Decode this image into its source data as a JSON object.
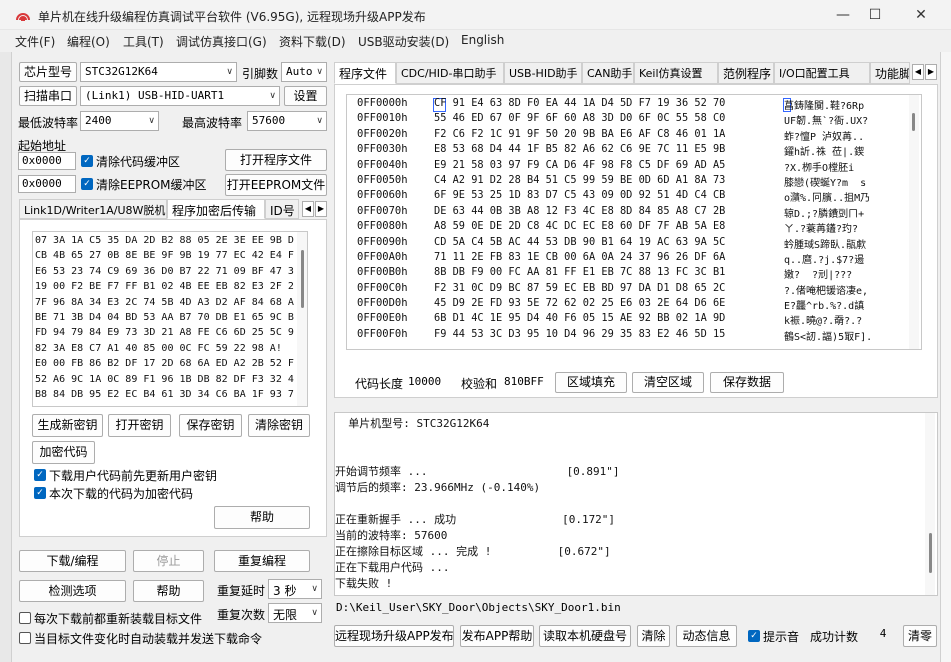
{
  "window": {
    "title": "单片机在线升级编程仿真调试平台软件 (V6.95G), 远程现场升级APP发布",
    "minimize": "—",
    "maximize": "☐",
    "close": "✕"
  },
  "menu": [
    "文件(F)",
    "编程(O)",
    "工具(T)",
    "调试仿真接口(G)",
    "资料下载(D)",
    "USB驱动安装(D)",
    "English"
  ],
  "left": {
    "chip_btn": "芯片型号",
    "chip_value": "STC32G12K64",
    "pin_label": "引脚数",
    "pin_value": "Auto",
    "scan_btn": "扫描串口",
    "port_value": "(Link1) USB-HID-UART1",
    "settings_btn": "设置",
    "min_baud_label": "最低波特率",
    "min_baud_value": "2400",
    "max_baud_label": "最高波特率",
    "max_baud_value": "57600",
    "start_addr_label": "起始地址",
    "addr1": "0x0000",
    "clear_code_label": "清除代码缓冲区",
    "open_prog_btn": "打开程序文件",
    "addr2": "0x0000",
    "clear_eeprom_label": "清除EEPROM缓冲区",
    "open_eeprom_btn": "打开EEPROM文件",
    "tabs": [
      "Link1D/Writer1A/U8W脱机",
      "程序加密后传输",
      "ID号"
    ],
    "hex_lines": [
      "07 3A 1A C5 35 DA 2D B2 88 05 2E 3E EE 9B D(",
      "CB 4B 65 27 0B 8E BE 9F 9B 19 77 EC 42 E4 F",
      "E6 53 23 74 C9 69 36 D0 B7 22 71 09 BF 47 3!",
      "19 00 F2 BE F7 FF B1 02 4B EE EB 82 E3 2F 2",
      "7F 96 8A 34 E3 2C 74 5B 4D A3 D2 AF 84 68 A",
      "BE 71 3B D4 04 BD 53 AA B7 70 DB E1 65 9C B(",
      "FD 94 79 84 E9 73 3D 21 A8 FE C6 6D 25 5C 9",
      "82 3A E8 C7 A1 40 85 00 0C FC 59 22 98 A!",
      "E0 00 FB 86 B2 DF 17 2D 68 6A ED A2 2B 52 F(",
      "52 A6 9C 1A 0C 89 F1 96 1B DB 82 DF F3 32 4",
      "B8 84 DB 95 E2 EC B4 61 3D 34 C6 BA 1F 93 7"
    ],
    "gen_key_btn": "生成新密钥",
    "open_key_btn": "打开密钥",
    "save_key_btn": "保存密钥",
    "clear_key_btn": "清除密钥",
    "encrypt_btn": "加密代码",
    "update_key_label": "下载用户代码前先更新用户密钥",
    "encrypt_download_label": "本次下载的代码为加密代码",
    "help_btn": "帮助",
    "download_btn": "下载/编程",
    "stop_btn": "停止",
    "reprogram_btn": "重复编程",
    "check_btn": "检测选项",
    "help2_btn": "帮助",
    "repeat_delay_label": "重复延时",
    "repeat_delay_value": "3 秒",
    "repeat_count_label": "重复次数",
    "repeat_count_value": "无限",
    "reload_label": "每次下载前都重新装载目标文件",
    "auto_label": "当目标文件变化时自动装载并发送下载命令"
  },
  "right": {
    "tabs": [
      "程序文件",
      "CDC/HID-串口助手",
      "USB-HID助手",
      "CAN助手",
      "Keil仿真设置",
      "范例程序",
      "I/O口配置工具",
      "功能脚"
    ],
    "hexdump": [
      {
        "addr": "0FF0000h",
        "bytes": "CF 91 E4 63 8D F0 EA 44 1A D4 5D F7 19 36 52 70",
        "ascii": "菖鋳隆闃.鞋?6Rp"
      },
      {
        "addr": "0FF0010h",
        "bytes": "55 46 ED 67 0F 9F 6F 60 A8 3D D0 6F 0C 55 58 C0",
        "ascii": "UF韌.無`?衙.UX?"
      },
      {
        "addr": "0FF0020h",
        "bytes": "F2 C6 F2 1C 91 9F 50 20 9B BA E6 AF C8 46 01 1A",
        "ascii": "蚱?憻P 泸奴苒.."
      },
      {
        "addr": "0FF0030h",
        "bytes": "E8 53 68 D4 44 1F B5 82 A6 62 C6 9E 7C 11 E5 9B",
        "ascii": "鑃h訢.祩 莅|.鍥"
      },
      {
        "addr": "0FF0040h",
        "bytes": "E9 21 58 03 97 F9 CA D6 4F 98 F8 C5 DF 69 AD A5",
        "ascii": "?X.栁手O樘胚i"
      },
      {
        "addr": "0FF0050h",
        "bytes": "C4 A2 91 D2 28 B4 51 C5 99 59 BE 0D 6D A1 8A 73",
        "ascii": "膝戀(碶蜒Y?m  s"
      },
      {
        "addr": "0FF0060h",
        "bytes": "6F 9E 53 25 1D 83 D7 C5 43 09 0D 92 51 4D C4 CB",
        "ascii": "o濻%.冋臏..抯M乃"
      },
      {
        "addr": "0FF0070h",
        "bytes": "DE 63 44 0B 3B A8 12 F3 4C E8 8D 84 85 A8 C7 2B",
        "ascii": "辌D.;?膦鐨剅ㄇ+"
      },
      {
        "addr": "0FF0080h",
        "bytes": "A8 59 0E DE 2D C8 4C DC EC E8 60 DF 7F AB 5A E8",
        "ascii": "ㄚ.?蓑苒鑉?玓?"
      },
      {
        "addr": "0FF0090h",
        "bytes": "CD 5A C4 5B AC 44 53 DB 90 B1 64 19 AC 63 9A 5C",
        "ascii": "蚙腫琙S蹄臥.瓹歑"
      },
      {
        "addr": "0FF00A0h",
        "bytes": "71 11 2E FB 83 1E CB 00 6A 0A 24 37 96 26 DF 6A",
        "ascii": "q..麿.?j.$7?逿"
      },
      {
        "addr": "0FF00B0h",
        "bytes": "8B DB F9 00 FC AA 81 FF E1 EB 7C 88 13 FC 3C B1",
        "ascii": "嫩?  ?刓|???"
      },
      {
        "addr": "0FF00C0h",
        "bytes": "F2 31 0C D9 BC 87 59 EC EB BD 97 DA D1 D8 65 2C",
        "ascii": "?.偖唵杷锾谘凄e,"
      },
      {
        "addr": "0FF00D0h",
        "bytes": "45 D9 2E FD 93 5E 72 62 02 25 E6 03 2E 64 D6 6E",
        "ascii": "E?龘^rb.%?.d謓"
      },
      {
        "addr": "0FF00E0h",
        "bytes": "6B D1 4C 1E 95 D4 40 F6 05 15 AE 92 BB 02 1A 9D",
        "ascii": "k裖.曉@?.奣?.?"
      },
      {
        "addr": "0FF00F0h",
        "bytes": "F9 44 53 3C D3 95 10 D4 96 29 35 83 E2 46 5D 15",
        "ascii": "鶴S<訒.諨)5冣F]."
      }
    ],
    "code_len_label": "代码长度",
    "code_len_value": "10000",
    "checksum_label": "校验和",
    "checksum_value": "810BFF",
    "fill_btn": "区域填充",
    "clear_area_btn": "清空区域",
    "save_data_btn": "保存数据",
    "log_lines": [
      "  单片机型号: STC32G12K64",
      "",
      "",
      "开始调节频率 ...                     [0.891\"]",
      "调节后的频率: 23.966MHz (-0.140%)",
      "",
      "正在重新握手 ... 成功                [0.172\"]",
      "当前的波特率: 57600",
      "正在擦除目标区域 ... 完成 !          [0.672\"]",
      "正在下载用户代码 ...",
      "下载失败 !"
    ],
    "file_path": "D:\\Keil_User\\SKY_Door\\Objects\\SKY_Door1.bin",
    "publish_btn": "远程现场升级APP发布",
    "publish_help_btn": "发布APP帮助",
    "read_disk_btn": "读取本机硬盘号",
    "clear_btn": "清除",
    "animate_btn": "动态信息",
    "sound_label": "提示音",
    "success_label": "成功计数",
    "success_value": "4",
    "clear_zero_btn": "清零"
  }
}
